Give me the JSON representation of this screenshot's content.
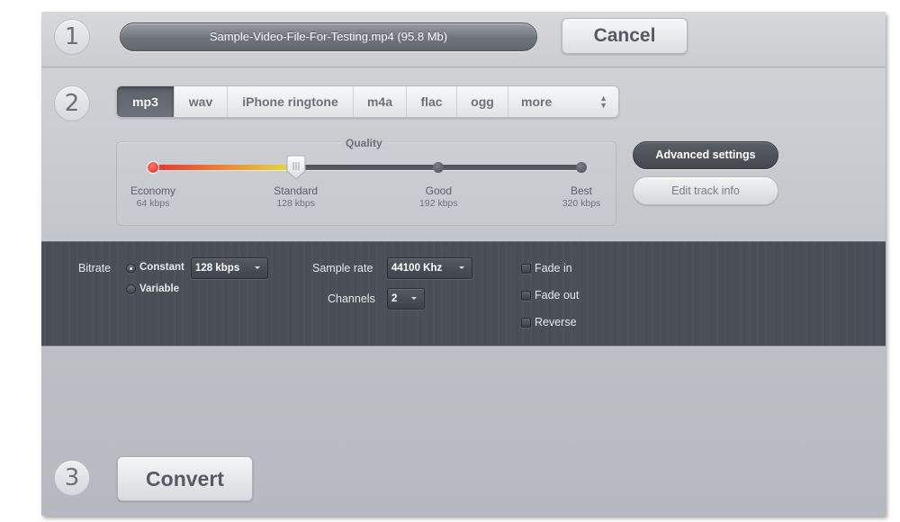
{
  "steps": {
    "step1": "1",
    "step2": "2",
    "step3": "3"
  },
  "file": {
    "label": "Sample-Video-File-For-Testing.mp4 (95.8 Mb)",
    "name": "Sample-Video-File-For-Testing.mp4",
    "size": "95.8 Mb"
  },
  "buttons": {
    "cancel": "Cancel",
    "advanced_settings": "Advanced settings",
    "edit_track_info": "Edit track info",
    "convert": "Convert"
  },
  "formats": {
    "selected": "mp3",
    "tabs": [
      {
        "label": "mp3",
        "active": true
      },
      {
        "label": "wav",
        "active": false
      },
      {
        "label": "iPhone ringtone",
        "active": false
      },
      {
        "label": "m4a",
        "active": false
      },
      {
        "label": "flac",
        "active": false
      },
      {
        "label": "ogg",
        "active": false
      },
      {
        "label": "more",
        "active": false
      }
    ],
    "more_icon": "updown-arrows-icon"
  },
  "quality": {
    "title": "Quality",
    "selected_index": 1,
    "selected_fraction": 0.333,
    "stops": [
      {
        "name": "Economy",
        "bitrate": "64 kbps"
      },
      {
        "name": "Standard",
        "bitrate": "128 kbps"
      },
      {
        "name": "Good",
        "bitrate": "192 kbps"
      },
      {
        "name": "Best",
        "bitrate": "320 kbps"
      }
    ],
    "colors": {
      "fill_start": "#e8342e",
      "fill_end": "#d8de3e",
      "track": "#55595f"
    }
  },
  "advanced": {
    "bitrate_label": "Bitrate",
    "bitrate_mode": {
      "options": [
        "Constant",
        "Variable"
      ],
      "selected": "Constant"
    },
    "bitrate_value": "128 kbps",
    "sample_rate_label": "Sample rate",
    "sample_rate_value": "44100 Khz",
    "channels_label": "Channels",
    "channels_value": "2",
    "checkboxes": [
      {
        "label": "Fade in",
        "checked": false
      },
      {
        "label": "Fade out",
        "checked": false
      },
      {
        "label": "Reverse",
        "checked": false
      }
    ]
  },
  "colors": {
    "panel_bg": "#c3c7cc",
    "dark_panel": "#4b4f57",
    "active_tab": "#636870"
  }
}
